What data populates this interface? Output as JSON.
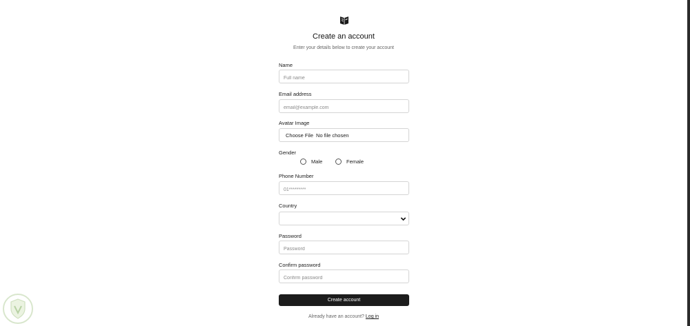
{
  "header": {
    "title": "Create an account",
    "subtitle": "Enter your details below to create your account",
    "logo_icon": "book-logo-icon"
  },
  "form": {
    "name": {
      "label": "Name",
      "placeholder": "Full name"
    },
    "email": {
      "label": "Email address",
      "placeholder": "email@example.com"
    },
    "avatar": {
      "label": "Avatar Image",
      "button_label": "Choose File",
      "status": "No file chosen"
    },
    "gender": {
      "label": "Gender",
      "options": [
        "Male",
        "Female"
      ]
    },
    "phone": {
      "label": "Phone Number",
      "placeholder": "01*********"
    },
    "country": {
      "label": "Country",
      "value": ""
    },
    "password": {
      "label": "Password",
      "placeholder": "Password"
    },
    "confirm_password": {
      "label": "Confirm password",
      "placeholder": "Confirm password"
    },
    "submit_label": "Create account"
  },
  "footer": {
    "prompt": "Already have an account?",
    "link_label": "Log in"
  },
  "colors": {
    "primary_button": "#1c1c1c",
    "border": "#d4d4d4",
    "muted_text": "#666666"
  }
}
